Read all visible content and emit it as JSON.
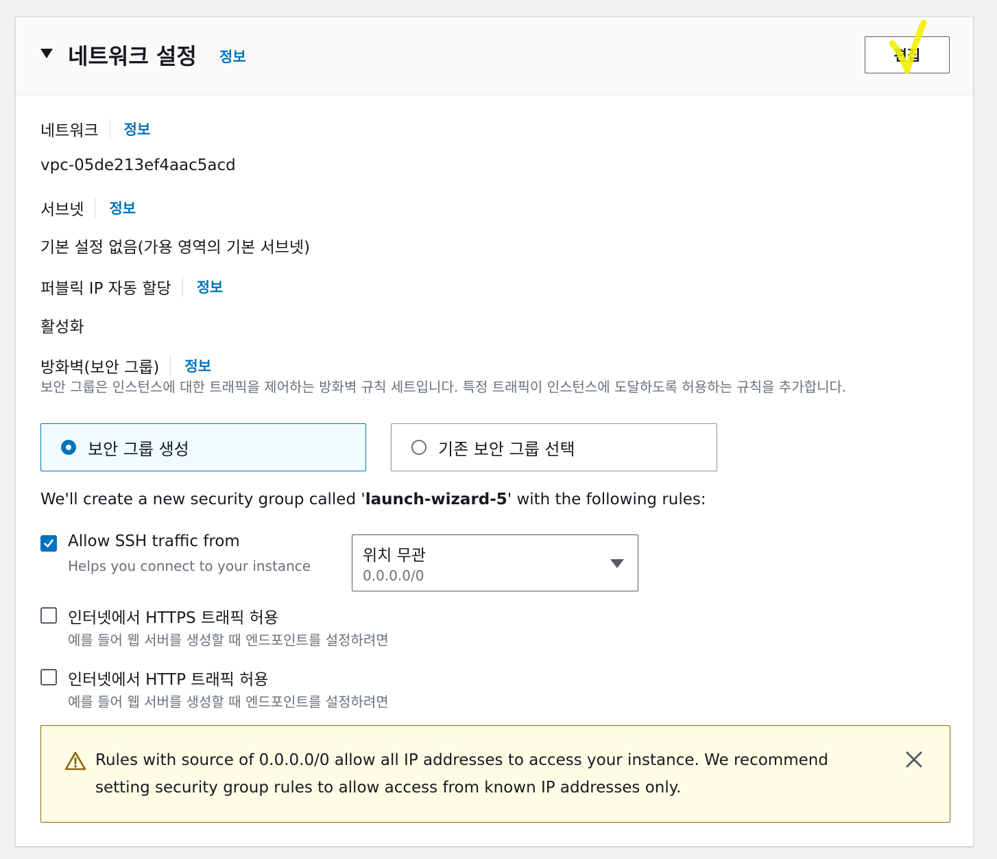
{
  "section": {
    "title": "네트워크 설정",
    "info_label": "정보",
    "edit_label": "편집"
  },
  "fields": {
    "network": {
      "label": "네트워크",
      "info": "정보",
      "value": "vpc-05de213ef4aac5acd"
    },
    "subnet": {
      "label": "서브넷",
      "info": "정보",
      "value": "기본 설정 없음(가용 영역의 기본 서브넷)"
    },
    "public_ip": {
      "label": "퍼블릭 IP 자동 할당",
      "info": "정보",
      "value": "활성화"
    },
    "firewall": {
      "label": "방화벽(보안 그룹)",
      "info": "정보",
      "description": "보안 그룹은 인스턴스에 대한 트래픽을 제어하는 방화벽 규칙 세트입니다. 특정 트래픽이 인스턴스에 도달하도록 허용하는 규칙을 추가합니다."
    }
  },
  "security_group_options": [
    {
      "label": "보안 그룹 생성",
      "selected": true
    },
    {
      "label": "기존 보안 그룹 선택",
      "selected": false
    }
  ],
  "new_sg": {
    "prefix": "We'll create a new security group called '",
    "name": "launch-wizard-5",
    "suffix": "' with the following rules:"
  },
  "rules": {
    "ssh": {
      "label": "Allow SSH traffic from",
      "description": "Helps you connect to your instance",
      "checked": true,
      "source": {
        "value": "위치 무관",
        "sub": "0.0.0.0/0"
      }
    },
    "https": {
      "label": "인터넷에서 HTTPS 트래픽 허용",
      "description": "예를 들어 웹 서버를 생성할 때 엔드포인트를 설정하려면",
      "checked": false
    },
    "http": {
      "label": "인터넷에서 HTTP 트래픽 허용",
      "description": "예를 들어 웹 서버를 생성할 때 엔드포인트를 설정하려면",
      "checked": false
    }
  },
  "alert": {
    "icon": "warning-icon",
    "text": "Rules with source of 0.0.0.0/0 allow all IP addresses to access your instance. We recommend setting security group rules to allow access from known IP addresses only."
  },
  "colors": {
    "link": "#0073bb",
    "selected_bg": "#f1faff",
    "alert_bg": "#fffce6",
    "alert_border": "#8d6605",
    "highlight_mark": "#f2f000"
  }
}
